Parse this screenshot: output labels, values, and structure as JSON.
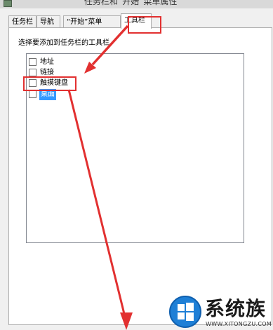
{
  "window": {
    "title": "任务栏和“开始”菜单属性"
  },
  "tabs": [
    {
      "label": "任务栏"
    },
    {
      "label": "导航"
    },
    {
      "label": "“开始”菜单"
    },
    {
      "label": "工具栏",
      "active": true
    }
  ],
  "toolbars": {
    "prompt": "选择要添加到任务栏的工具栏。",
    "items": [
      {
        "label": "地址",
        "checked": false
      },
      {
        "label": "链接",
        "checked": false
      },
      {
        "label": "触摸键盘",
        "checked": false
      },
      {
        "label": "桌面",
        "checked": false,
        "selected": true
      }
    ]
  },
  "watermark": {
    "brand": "系统族",
    "url": "WWW.XITONGZU.COM"
  },
  "colors": {
    "annotation": "#e23030",
    "selection": "#3399ff"
  }
}
